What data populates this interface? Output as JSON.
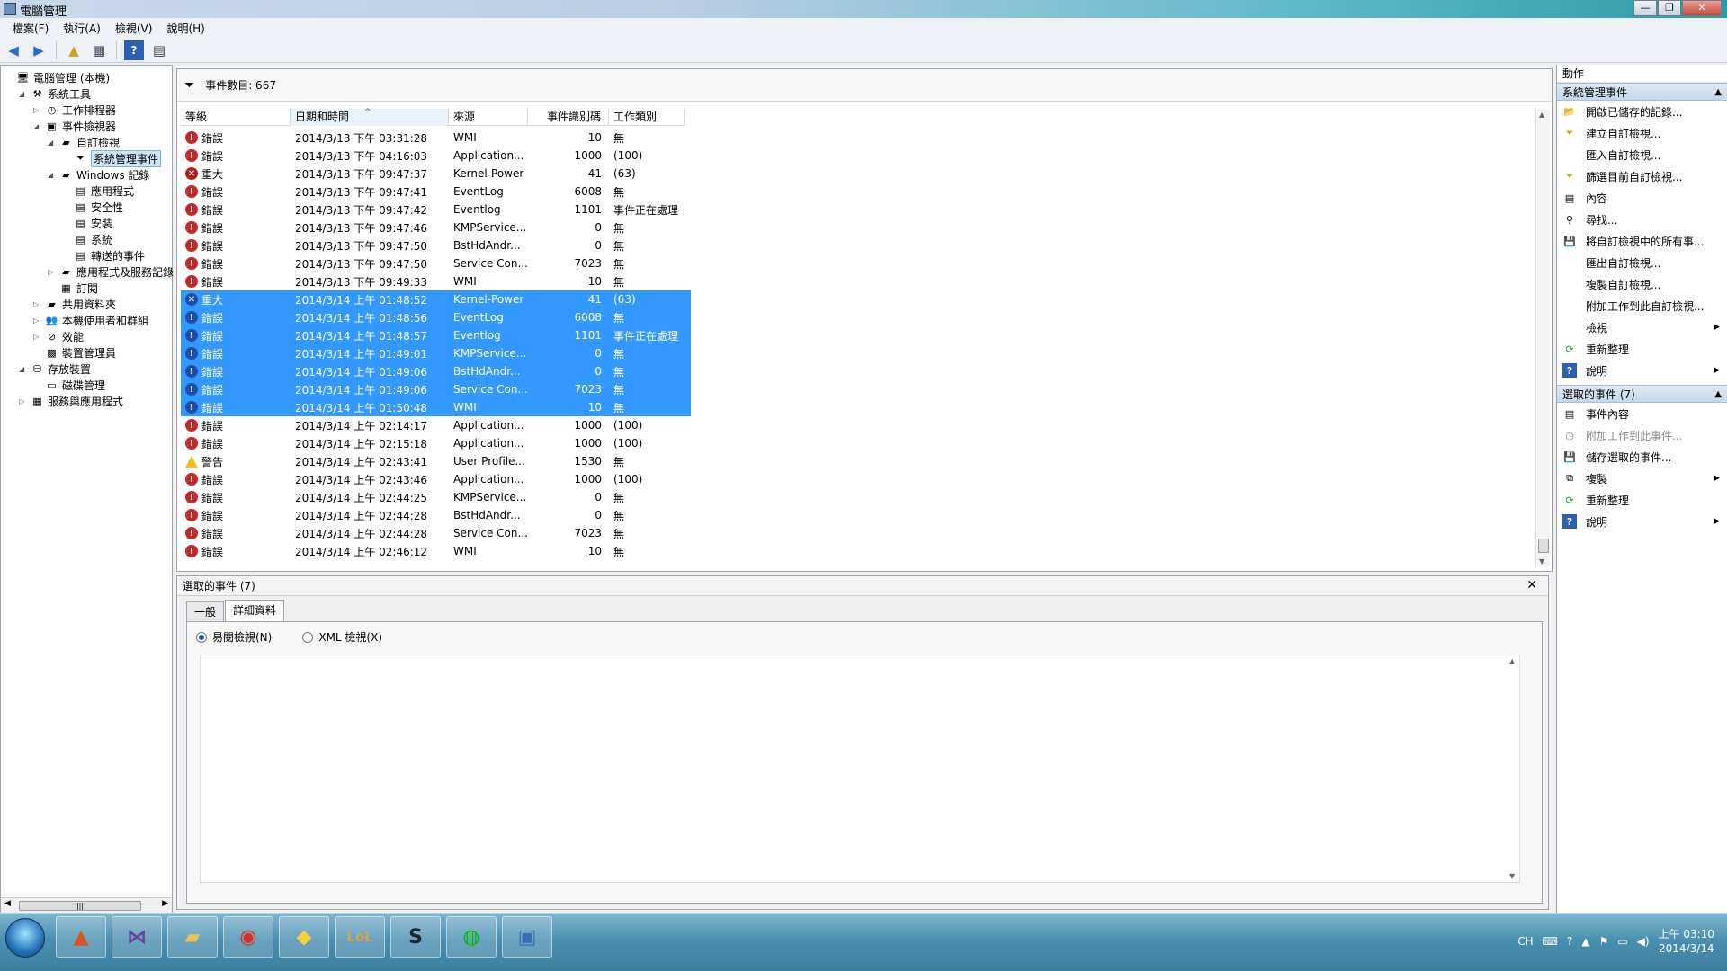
{
  "window": {
    "title": "電腦管理"
  },
  "menu": [
    "檔案(F)",
    "執行(A)",
    "檢視(V)",
    "說明(H)"
  ],
  "tree": [
    {
      "label": "電腦管理 (本機)",
      "depth": 0,
      "twisty": "",
      "icon": "computer-icon"
    },
    {
      "label": "系統工具",
      "depth": 1,
      "twisty": "◢",
      "icon": "tools-icon"
    },
    {
      "label": "工作排程器",
      "depth": 2,
      "twisty": "▷",
      "icon": "clock-icon"
    },
    {
      "label": "事件檢視器",
      "depth": 2,
      "twisty": "◢",
      "icon": "event-viewer-icon"
    },
    {
      "label": "自訂檢視",
      "depth": 3,
      "twisty": "◢",
      "icon": "folder-icon"
    },
    {
      "label": "系統管理事件",
      "depth": 4,
      "twisty": "",
      "icon": "filter-icon",
      "selected": true
    },
    {
      "label": "Windows 記錄",
      "depth": 3,
      "twisty": "◢",
      "icon": "folder-icon"
    },
    {
      "label": "應用程式",
      "depth": 4,
      "twisty": "",
      "icon": "log-icon"
    },
    {
      "label": "安全性",
      "depth": 4,
      "twisty": "",
      "icon": "log-icon"
    },
    {
      "label": "安裝",
      "depth": 4,
      "twisty": "",
      "icon": "log-icon"
    },
    {
      "label": "系統",
      "depth": 4,
      "twisty": "",
      "icon": "log-icon"
    },
    {
      "label": "轉送的事件",
      "depth": 4,
      "twisty": "",
      "icon": "log-icon"
    },
    {
      "label": "應用程式及服務記錄",
      "depth": 3,
      "twisty": "▷",
      "icon": "folder-icon"
    },
    {
      "label": "訂閱",
      "depth": 3,
      "twisty": "",
      "icon": "subscription-icon"
    },
    {
      "label": "共用資料夾",
      "depth": 2,
      "twisty": "▷",
      "icon": "shared-folder-icon"
    },
    {
      "label": "本機使用者和群組",
      "depth": 2,
      "twisty": "▷",
      "icon": "users-icon"
    },
    {
      "label": "效能",
      "depth": 2,
      "twisty": "▷",
      "icon": "performance-icon"
    },
    {
      "label": "裝置管理員",
      "depth": 2,
      "twisty": "",
      "icon": "device-manager-icon"
    },
    {
      "label": "存放裝置",
      "depth": 1,
      "twisty": "◢",
      "icon": "storage-icon"
    },
    {
      "label": "磁碟管理",
      "depth": 2,
      "twisty": "",
      "icon": "disk-icon"
    },
    {
      "label": "服務與應用程式",
      "depth": 1,
      "twisty": "▷",
      "icon": "services-icon"
    }
  ],
  "events": {
    "count_text": "事件數目: 667",
    "columns": [
      "等級",
      "日期和時間",
      "來源",
      "事件識別碼",
      "工作類別"
    ],
    "rows": [
      {
        "level": "錯誤",
        "type": "error",
        "date": "2014/3/13 下午 03:31:28",
        "source": "WMI",
        "id": "10",
        "category": "無"
      },
      {
        "level": "錯誤",
        "type": "error",
        "date": "2014/3/13 下午 04:16:03",
        "source": "Application...",
        "id": "1000",
        "category": "(100)"
      },
      {
        "level": "重大",
        "type": "critical",
        "date": "2014/3/13 下午 09:47:37",
        "source": "Kernel-Power",
        "id": "41",
        "category": "(63)"
      },
      {
        "level": "錯誤",
        "type": "error",
        "date": "2014/3/13 下午 09:47:41",
        "source": "EventLog",
        "id": "6008",
        "category": "無"
      },
      {
        "level": "錯誤",
        "type": "error",
        "date": "2014/3/13 下午 09:47:42",
        "source": "Eventlog",
        "id": "1101",
        "category": "事件正在處理"
      },
      {
        "level": "錯誤",
        "type": "error",
        "date": "2014/3/13 下午 09:47:46",
        "source": "KMPService...",
        "id": "0",
        "category": "無"
      },
      {
        "level": "錯誤",
        "type": "error",
        "date": "2014/3/13 下午 09:47:50",
        "source": "BstHdAndr...",
        "id": "0",
        "category": "無"
      },
      {
        "level": "錯誤",
        "type": "error",
        "date": "2014/3/13 下午 09:47:50",
        "source": "Service Con...",
        "id": "7023",
        "category": "無"
      },
      {
        "level": "錯誤",
        "type": "error",
        "date": "2014/3/13 下午 09:49:33",
        "source": "WMI",
        "id": "10",
        "category": "無"
      },
      {
        "level": "重大",
        "type": "critical",
        "date": "2014/3/14 上午 01:48:52",
        "source": "Kernel-Power",
        "id": "41",
        "category": "(63)",
        "selected": true
      },
      {
        "level": "錯誤",
        "type": "error",
        "date": "2014/3/14 上午 01:48:56",
        "source": "EventLog",
        "id": "6008",
        "category": "無",
        "selected": true
      },
      {
        "level": "錯誤",
        "type": "error",
        "date": "2014/3/14 上午 01:48:57",
        "source": "Eventlog",
        "id": "1101",
        "category": "事件正在處理",
        "selected": true
      },
      {
        "level": "錯誤",
        "type": "error",
        "date": "2014/3/14 上午 01:49:01",
        "source": "KMPService...",
        "id": "0",
        "category": "無",
        "selected": true
      },
      {
        "level": "錯誤",
        "type": "error",
        "date": "2014/3/14 上午 01:49:06",
        "source": "BstHdAndr...",
        "id": "0",
        "category": "無",
        "selected": true
      },
      {
        "level": "錯誤",
        "type": "error",
        "date": "2014/3/14 上午 01:49:06",
        "source": "Service Con...",
        "id": "7023",
        "category": "無",
        "selected": true
      },
      {
        "level": "錯誤",
        "type": "error",
        "date": "2014/3/14 上午 01:50:48",
        "source": "WMI",
        "id": "10",
        "category": "無",
        "selected": true
      },
      {
        "level": "錯誤",
        "type": "error",
        "date": "2014/3/14 上午 02:14:17",
        "source": "Application...",
        "id": "1000",
        "category": "(100)"
      },
      {
        "level": "錯誤",
        "type": "error",
        "date": "2014/3/14 上午 02:15:18",
        "source": "Application...",
        "id": "1000",
        "category": "(100)"
      },
      {
        "level": "警告",
        "type": "warning",
        "date": "2014/3/14 上午 02:43:41",
        "source": "User Profile...",
        "id": "1530",
        "category": "無"
      },
      {
        "level": "錯誤",
        "type": "error",
        "date": "2014/3/14 上午 02:43:46",
        "source": "Application...",
        "id": "1000",
        "category": "(100)"
      },
      {
        "level": "錯誤",
        "type": "error",
        "date": "2014/3/14 上午 02:44:25",
        "source": "KMPService...",
        "id": "0",
        "category": "無"
      },
      {
        "level": "錯誤",
        "type": "error",
        "date": "2014/3/14 上午 02:44:28",
        "source": "BstHdAndr...",
        "id": "0",
        "category": "無"
      },
      {
        "level": "錯誤",
        "type": "error",
        "date": "2014/3/14 上午 02:44:28",
        "source": "Service Con...",
        "id": "7023",
        "category": "無"
      },
      {
        "level": "錯誤",
        "type": "error",
        "date": "2014/3/14 上午 02:46:12",
        "source": "WMI",
        "id": "10",
        "category": "無"
      }
    ]
  },
  "details": {
    "title": "選取的事件 (7)",
    "tabs": [
      "一般",
      "詳細資料"
    ],
    "active_tab": 1,
    "radio_friendly": "易閱檢視(N)",
    "radio_xml": "XML 檢視(X)"
  },
  "actions": {
    "title": "動作",
    "group1": "系統管理事件",
    "group1_items": [
      {
        "label": "開啟已儲存的記錄...",
        "icon": "open-log-icon"
      },
      {
        "label": "建立自訂檢視...",
        "icon": "create-view-icon"
      },
      {
        "label": "匯入自訂檢視...",
        "icon": ""
      },
      {
        "label": "篩選目前自訂檢視...",
        "icon": "filter-icon"
      },
      {
        "label": "內容",
        "icon": "properties-icon"
      },
      {
        "label": "尋找...",
        "icon": "find-icon"
      },
      {
        "label": "將自訂檢視中的所有事...",
        "icon": "save-icon"
      },
      {
        "label": "匯出自訂檢視...",
        "icon": ""
      },
      {
        "label": "複製自訂檢視...",
        "icon": ""
      },
      {
        "label": "附加工作到此自訂檢視...",
        "icon": ""
      },
      {
        "label": "檢視",
        "icon": "",
        "more": true
      },
      {
        "label": "重新整理",
        "icon": "refresh-icon"
      },
      {
        "label": "說明",
        "icon": "help-icon",
        "more": true
      }
    ],
    "group2": "選取的事件 (7)",
    "group2_items": [
      {
        "label": "事件內容",
        "icon": "event-properties-icon"
      },
      {
        "label": "附加工作到此事件...",
        "icon": "attach-task-icon",
        "disabled": true
      },
      {
        "label": "儲存選取的事件...",
        "icon": "save-icon"
      },
      {
        "label": "複製",
        "icon": "copy-icon",
        "more": true
      },
      {
        "label": "重新整理",
        "icon": "refresh-icon"
      },
      {
        "label": "說明",
        "icon": "help-icon",
        "more": true
      }
    ]
  },
  "taskbar": {
    "apps": [
      "matlab-icon",
      "visual-studio-icon",
      "file-explorer-icon",
      "chrome-icon",
      "app-icon",
      "lol-icon",
      "steam-icon",
      "line-icon",
      "computer-management-icon"
    ],
    "tray_lang": "CH",
    "clock_time": "上午 03:10",
    "clock_date": "2014/3/14"
  }
}
